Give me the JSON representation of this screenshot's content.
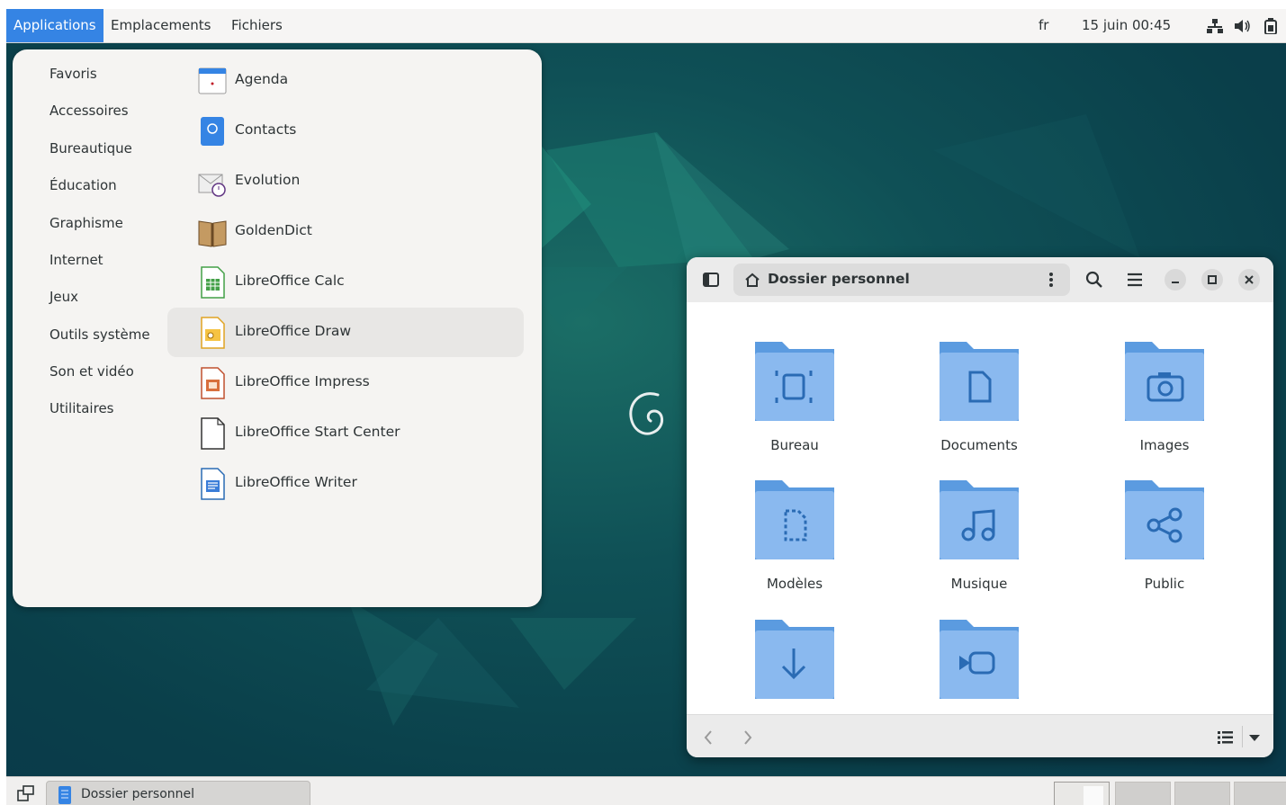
{
  "top_panel": {
    "menus": [
      "Applications",
      "Emplacements",
      "Fichiers"
    ],
    "lang": "fr",
    "clock": "15 juin 00:45",
    "tray_icons": [
      "network-icon",
      "volume-icon",
      "battery-icon"
    ]
  },
  "app_menu": {
    "categories": [
      "Favoris",
      "Accessoires",
      "Bureautique",
      "Éducation",
      "Graphisme",
      "Internet",
      "Jeux",
      "Outils système",
      "Son et vidéo",
      "Utilitaires"
    ],
    "apps": [
      {
        "label": "Agenda",
        "icon": "calendar-icon"
      },
      {
        "label": "Contacts",
        "icon": "contacts-icon"
      },
      {
        "label": "Evolution",
        "icon": "evolution-icon"
      },
      {
        "label": "GoldenDict",
        "icon": "dictionary-icon"
      },
      {
        "label": "LibreOffice Calc",
        "icon": "calc-icon"
      },
      {
        "label": "LibreOffice Draw",
        "icon": "draw-icon"
      },
      {
        "label": "LibreOffice Impress",
        "icon": "impress-icon"
      },
      {
        "label": "LibreOffice Start Center",
        "icon": "startcenter-icon"
      },
      {
        "label": "LibreOffice Writer",
        "icon": "writer-icon"
      }
    ],
    "highlighted": "LibreOffice Draw"
  },
  "file_manager": {
    "title": "Dossier personnel",
    "folders": [
      {
        "name": "Bureau",
        "icon": "desktop-folder-icon"
      },
      {
        "name": "Documents",
        "icon": "documents-folder-icon"
      },
      {
        "name": "Images",
        "icon": "pictures-folder-icon"
      },
      {
        "name": "Modèles",
        "icon": "templates-folder-icon"
      },
      {
        "name": "Musique",
        "icon": "music-folder-icon"
      },
      {
        "name": "Public",
        "icon": "public-folder-icon"
      },
      {
        "name": "",
        "icon": "downloads-folder-icon"
      },
      {
        "name": "",
        "icon": "videos-folder-icon"
      }
    ]
  },
  "bottom_panel": {
    "task": "Dossier personnel"
  },
  "colors": {
    "accent": "#3584e4",
    "folder": "#6fa7e6",
    "desktop": "#0f4f57"
  }
}
